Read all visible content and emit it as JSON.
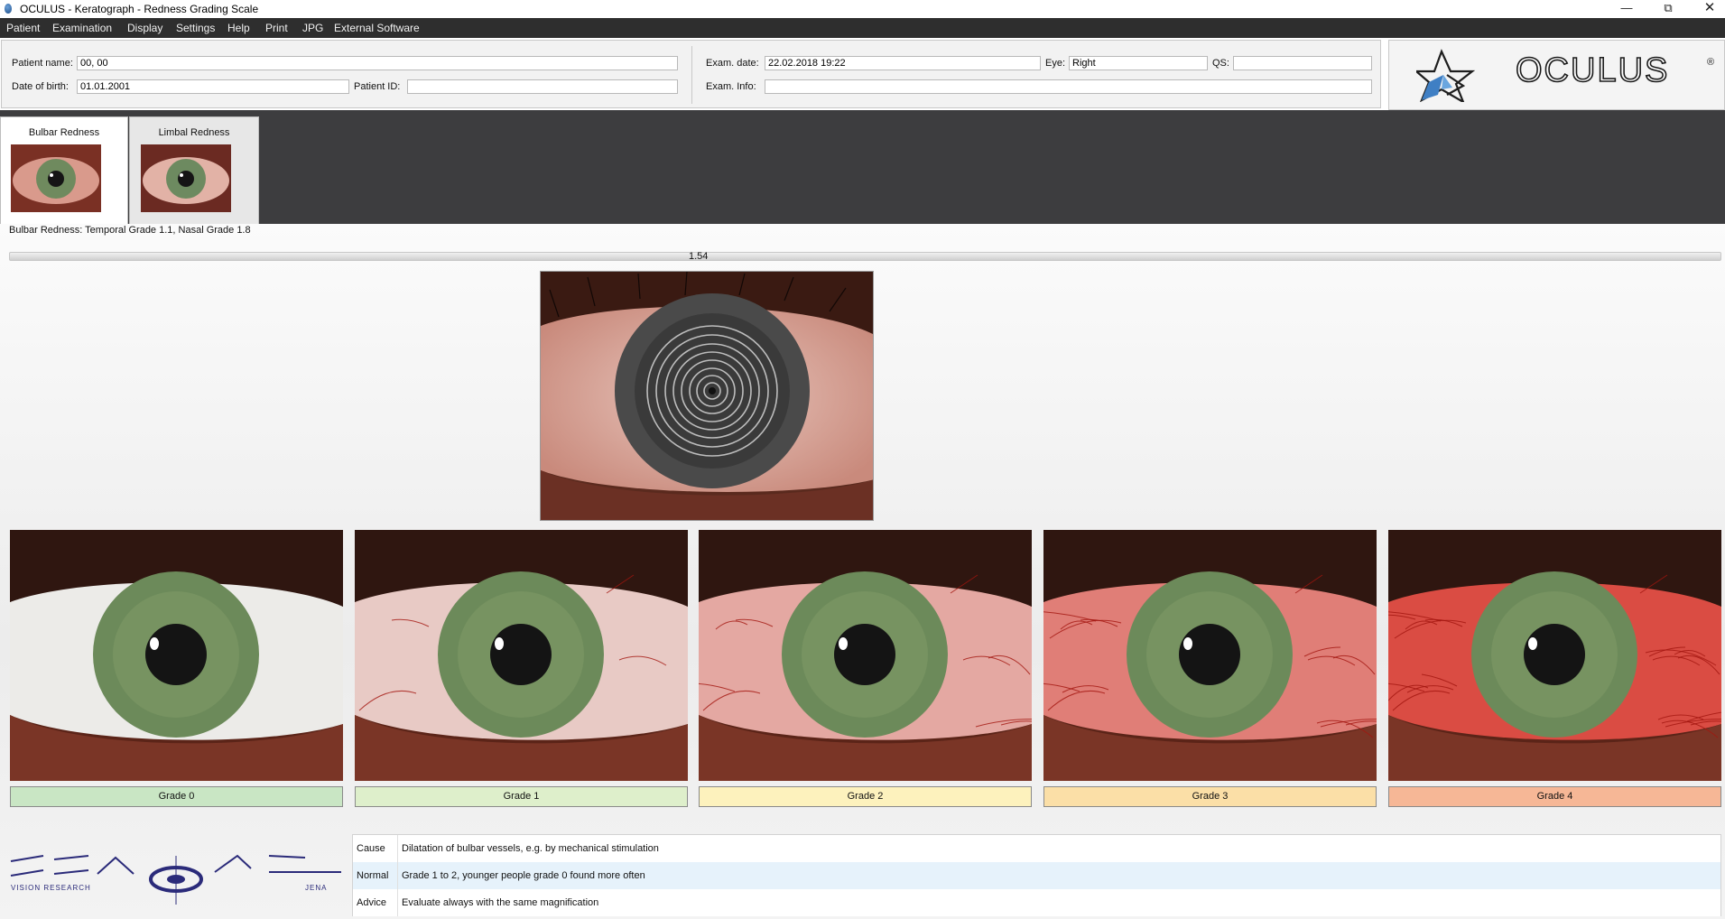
{
  "window": {
    "title": "OCULUS - Keratograph - Redness Grading Scale"
  },
  "menu": [
    "Patient",
    "Examination",
    "Display",
    "Settings",
    "Help",
    "Print",
    "JPG",
    "External Software"
  ],
  "patient": {
    "name_label": "Patient name:",
    "name_value": "00, 00",
    "dob_label": "Date of birth:",
    "dob_value": "01.01.2001",
    "id_label": "Patient ID:",
    "id_value": ""
  },
  "exam": {
    "date_label": "Exam. date:",
    "date_value": "22.02.2018 19:22",
    "eye_label": "Eye:",
    "eye_value": "Right",
    "qs_label": "QS:",
    "qs_value": "",
    "info_label": "Exam. Info:",
    "info_value": ""
  },
  "brand": {
    "logo_text": "OCULUS",
    "reg_mark": "®"
  },
  "tabs": [
    {
      "label": "Bulbar Redness",
      "active": true
    },
    {
      "label": "Limbal Redness",
      "active": false
    }
  ],
  "summary": "Bulbar Redness: Temporal Grade 1.1, Nasal Grade 1.8",
  "score": {
    "value": "1.54"
  },
  "grades": [
    {
      "label": "Grade 0",
      "color": "#c9e6c4",
      "redness": 0.0
    },
    {
      "label": "Grade 1",
      "color": "#deefcb",
      "redness": 0.2
    },
    {
      "label": "Grade 2",
      "color": "#fdf2bd",
      "redness": 0.4
    },
    {
      "label": "Grade 3",
      "color": "#fbdfa7",
      "redness": 0.65
    },
    {
      "label": "Grade 4",
      "color": "#f6b796",
      "redness": 0.95
    }
  ],
  "info": [
    {
      "key": "Cause",
      "value": "Dilatation of bulbar vessels, e.g. by mechanical stimulation"
    },
    {
      "key": "Normal",
      "value": "Grade 1 to 2, younger people grade 0 found more often"
    },
    {
      "key": "Advice",
      "value": "Evaluate always with the same magnification"
    }
  ],
  "footer_logo": {
    "left": "JEN",
    "right": "VIS",
    "sub_left": "VISION RESEARCH",
    "sub_right": "JENA"
  }
}
